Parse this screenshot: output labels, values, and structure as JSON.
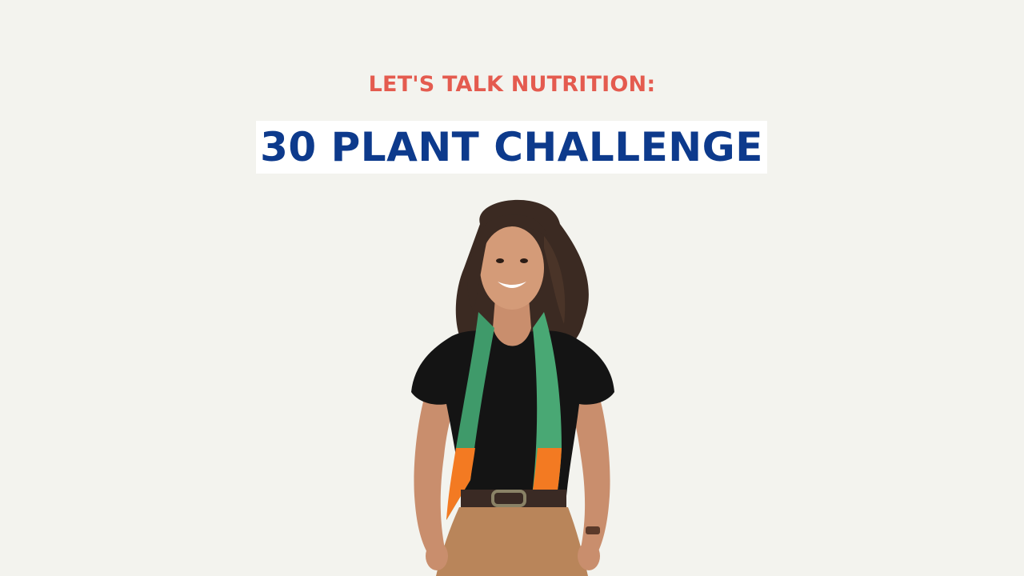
{
  "header": {
    "kicker": "LET'S TALK NUTRITION:",
    "title": "30 PLANT CHALLENGE"
  },
  "colors": {
    "background": "#f3f3ee",
    "kicker": "#e45b4f",
    "title": "#0d3a8c",
    "title_box": "#ffffff"
  },
  "image": {
    "subject": "smiling-woman-with-green-orange-scarf"
  }
}
